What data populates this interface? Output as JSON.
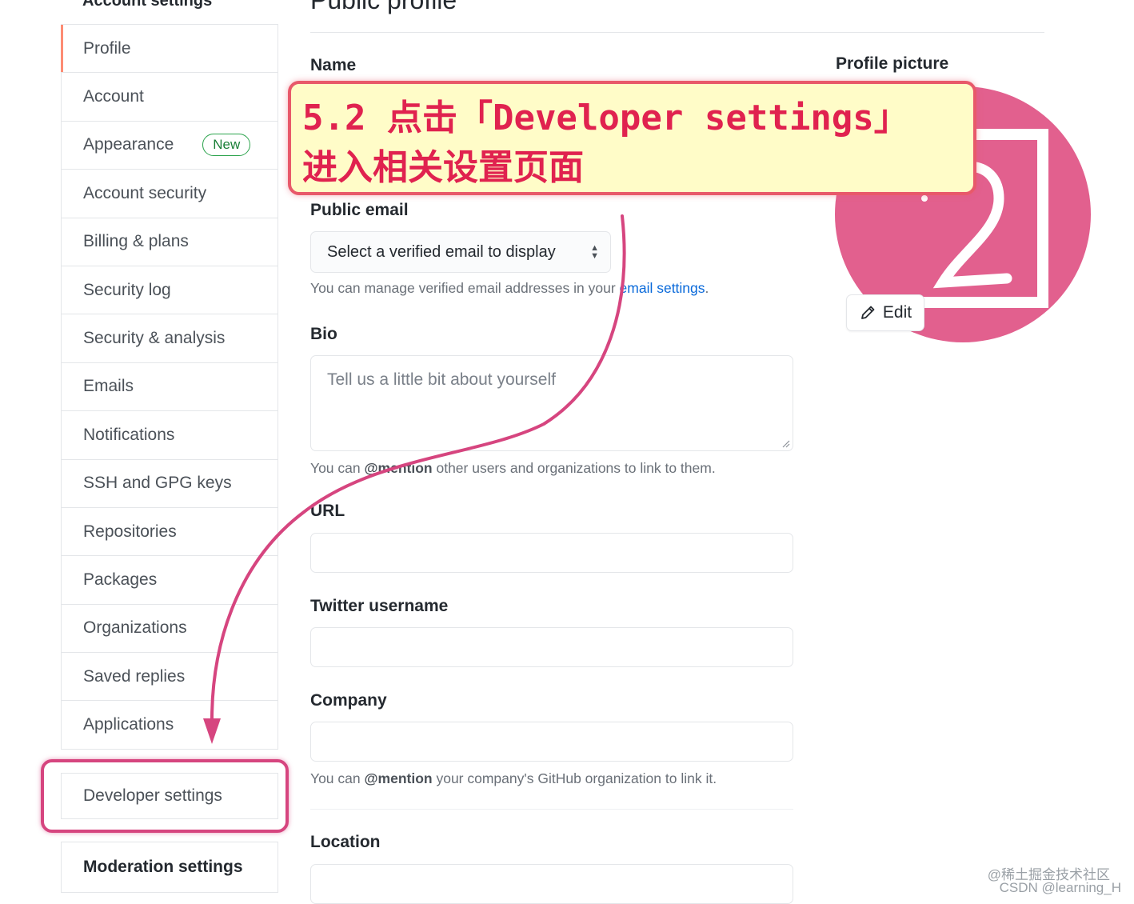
{
  "sidebar": {
    "heading": "Account settings",
    "items": [
      {
        "label": "Profile",
        "name": "sidebar-item-profile"
      },
      {
        "label": "Account",
        "name": "sidebar-item-account"
      },
      {
        "label": "Appearance",
        "name": "sidebar-item-appearance",
        "badge": "New"
      },
      {
        "label": "Account security",
        "name": "sidebar-item-account-security"
      },
      {
        "label": "Billing & plans",
        "name": "sidebar-item-billing"
      },
      {
        "label": "Security log",
        "name": "sidebar-item-security-log"
      },
      {
        "label": "Security & analysis",
        "name": "sidebar-item-security-analysis"
      },
      {
        "label": "Emails",
        "name": "sidebar-item-emails"
      },
      {
        "label": "Notifications",
        "name": "sidebar-item-notifications"
      },
      {
        "label": "SSH and GPG keys",
        "name": "sidebar-item-ssh-gpg-keys"
      },
      {
        "label": "Repositories",
        "name": "sidebar-item-repositories"
      },
      {
        "label": "Packages",
        "name": "sidebar-item-packages"
      },
      {
        "label": "Organizations",
        "name": "sidebar-item-organizations"
      },
      {
        "label": "Saved replies",
        "name": "sidebar-item-saved-replies"
      },
      {
        "label": "Applications",
        "name": "sidebar-item-applications"
      }
    ],
    "selected_index": 0,
    "developer_settings": "Developer settings",
    "moderation_settings": "Moderation settings"
  },
  "main": {
    "title": "Public profile",
    "name_label": "Name",
    "public_email_label": "Public email",
    "public_email_select": "Select a verified email to display",
    "email_note_prefix": "You can manage verified email addresses in your ",
    "email_note_link": "email settings",
    "email_note_suffix": ".",
    "bio_label": "Bio",
    "bio_placeholder": "Tell us a little bit about yourself",
    "bio_note_prefix": "You can ",
    "bio_note_mention": "@mention",
    "bio_note_suffix": " other users and organizations to link to them.",
    "url_label": "URL",
    "twitter_label": "Twitter username",
    "company_label": "Company",
    "company_note_prefix": "You can ",
    "company_note_mention": "@mention",
    "company_note_suffix": " your company's GitHub organization to link it.",
    "location_label": "Location"
  },
  "profile_picture": {
    "label": "Profile picture",
    "edit_label": "Edit",
    "avatar_color": "#e2608e"
  },
  "annotation": {
    "line1": "5.2 点击「Developer settings」",
    "line2": "进入相关设置页面",
    "text_color": "#e0224f",
    "border_color": "#e8596a",
    "arrow_color": "#d6457f"
  },
  "watermark": {
    "line1": "@稀土掘金技术社区",
    "line2": "CSDN @learning_H"
  },
  "colors": {
    "selected_accent": "#fd8c73",
    "link": "#0969da",
    "badge_green": "#1a7f37"
  }
}
